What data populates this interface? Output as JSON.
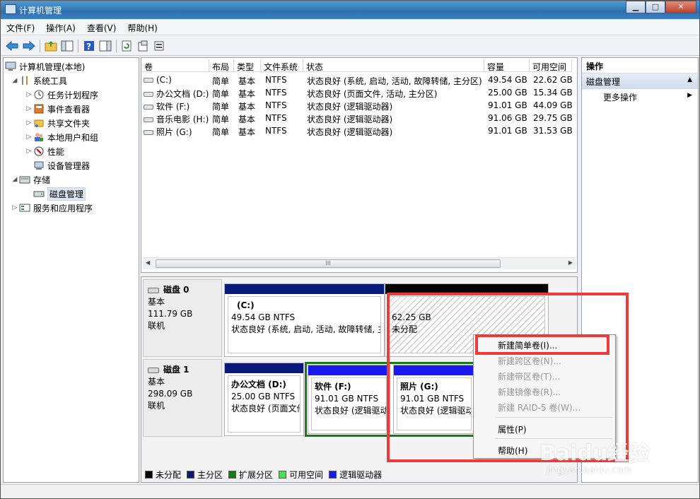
{
  "window": {
    "title": "计算机管理",
    "minimize": "▁",
    "maximize": "□",
    "close": "✕"
  },
  "menubar": [
    "文件(F)",
    "操作(A)",
    "查看(V)",
    "帮助(H)"
  ],
  "toolbar": [
    "back-icon",
    "forward-icon",
    "up-folder-icon",
    "show-hide-tree-icon",
    "help-icon",
    "action-pane-icon",
    "refresh-icon",
    "properties-icon",
    "export-icon"
  ],
  "tree": {
    "root": "计算机管理(本地)",
    "system_tools": "系统工具",
    "task_scheduler": "任务计划程序",
    "event_viewer": "事件查看器",
    "shared_folders": "共享文件夹",
    "local_users": "本地用户和组",
    "performance": "性能",
    "device_manager": "设备管理器",
    "storage": "存储",
    "disk_management": "磁盘管理",
    "services_apps": "服务和应用程序"
  },
  "volumes": {
    "headers": [
      "卷",
      "布局",
      "类型",
      "文件系统",
      "状态",
      "容量",
      "可用空间"
    ],
    "rows": [
      [
        "(C:)",
        "简单",
        "基本",
        "NTFS",
        "状态良好 (系统, 启动, 活动, 故障转储, 主分区)",
        "49.54 GB",
        "22.62 GB"
      ],
      [
        "办公文档 (D:)",
        "简单",
        "基本",
        "NTFS",
        "状态良好 (页面文件, 活动, 主分区)",
        "25.00 GB",
        "15.34 GB"
      ],
      [
        "软件 (F:)",
        "简单",
        "基本",
        "NTFS",
        "状态良好 (逻辑驱动器)",
        "91.01 GB",
        "44.09 GB"
      ],
      [
        "音乐电影 (H:)",
        "简单",
        "基本",
        "NTFS",
        "状态良好 (逻辑驱动器)",
        "91.06 GB",
        "29.75 GB"
      ],
      [
        "照片 (G:)",
        "简单",
        "基本",
        "NTFS",
        "状态良好 (逻辑驱动器)",
        "91.01 GB",
        "31.53 GB"
      ]
    ],
    "scroll_grip": "III"
  },
  "disks": {
    "disk0": {
      "name": "磁盘 0",
      "type": "基本",
      "size": "111.79 GB",
      "status": "联机",
      "c": {
        "name": "(C:)",
        "size": "49.54 GB NTFS",
        "status": "状态良好 (系统, 启动, 活动, 故障转储, 主"
      },
      "unalloc": {
        "size": "62.25 GB",
        "status": "未分配"
      }
    },
    "disk1": {
      "name": "磁盘 1",
      "type": "基本",
      "size": "298.09 GB",
      "status": "联机",
      "d": {
        "name": "办公文档  (D:)",
        "size": "25.00 GB NTFS",
        "status": "状态良好 (页面文件"
      },
      "f": {
        "name": "软件  (F:)",
        "size": "91.01 GB NTFS",
        "status": "状态良好 (逻辑驱动器"
      },
      "g": {
        "name": "照片  (G:)",
        "size": "91.01 GB NTFS",
        "status": "状态良好 (逻辑驱动"
      }
    }
  },
  "legend": [
    {
      "label": "未分配",
      "color": "#000000"
    },
    {
      "label": "主分区",
      "color": "#0a1a7a"
    },
    {
      "label": "扩展分区",
      "color": "#1a7a1a"
    },
    {
      "label": "可用空间",
      "color": "#3ee83e"
    },
    {
      "label": "逻辑驱动器",
      "color": "#1a1af0"
    }
  ],
  "actions": {
    "header": "操作",
    "section": "磁盘管理",
    "more": "更多操作"
  },
  "context_menu": {
    "new_simple": "新建简单卷(I)...",
    "new_spanned": "新建跨区卷(N)...",
    "new_striped": "新建带区卷(T)...",
    "new_mirrored": "新建镜像卷(R)...",
    "new_raid5": "新建 RAID-5 卷(W)...",
    "properties": "属性(P)",
    "help": "帮助(H)"
  },
  "watermark": {
    "brand": "Baidu经验",
    "url": "jingyan.baidu.com"
  },
  "colors": {
    "primary": "#0a1a7a",
    "logical": "#1a1af0",
    "extended": "#1a7a1a",
    "unallocated": "#000000",
    "highlight": "#ef3a3a"
  }
}
